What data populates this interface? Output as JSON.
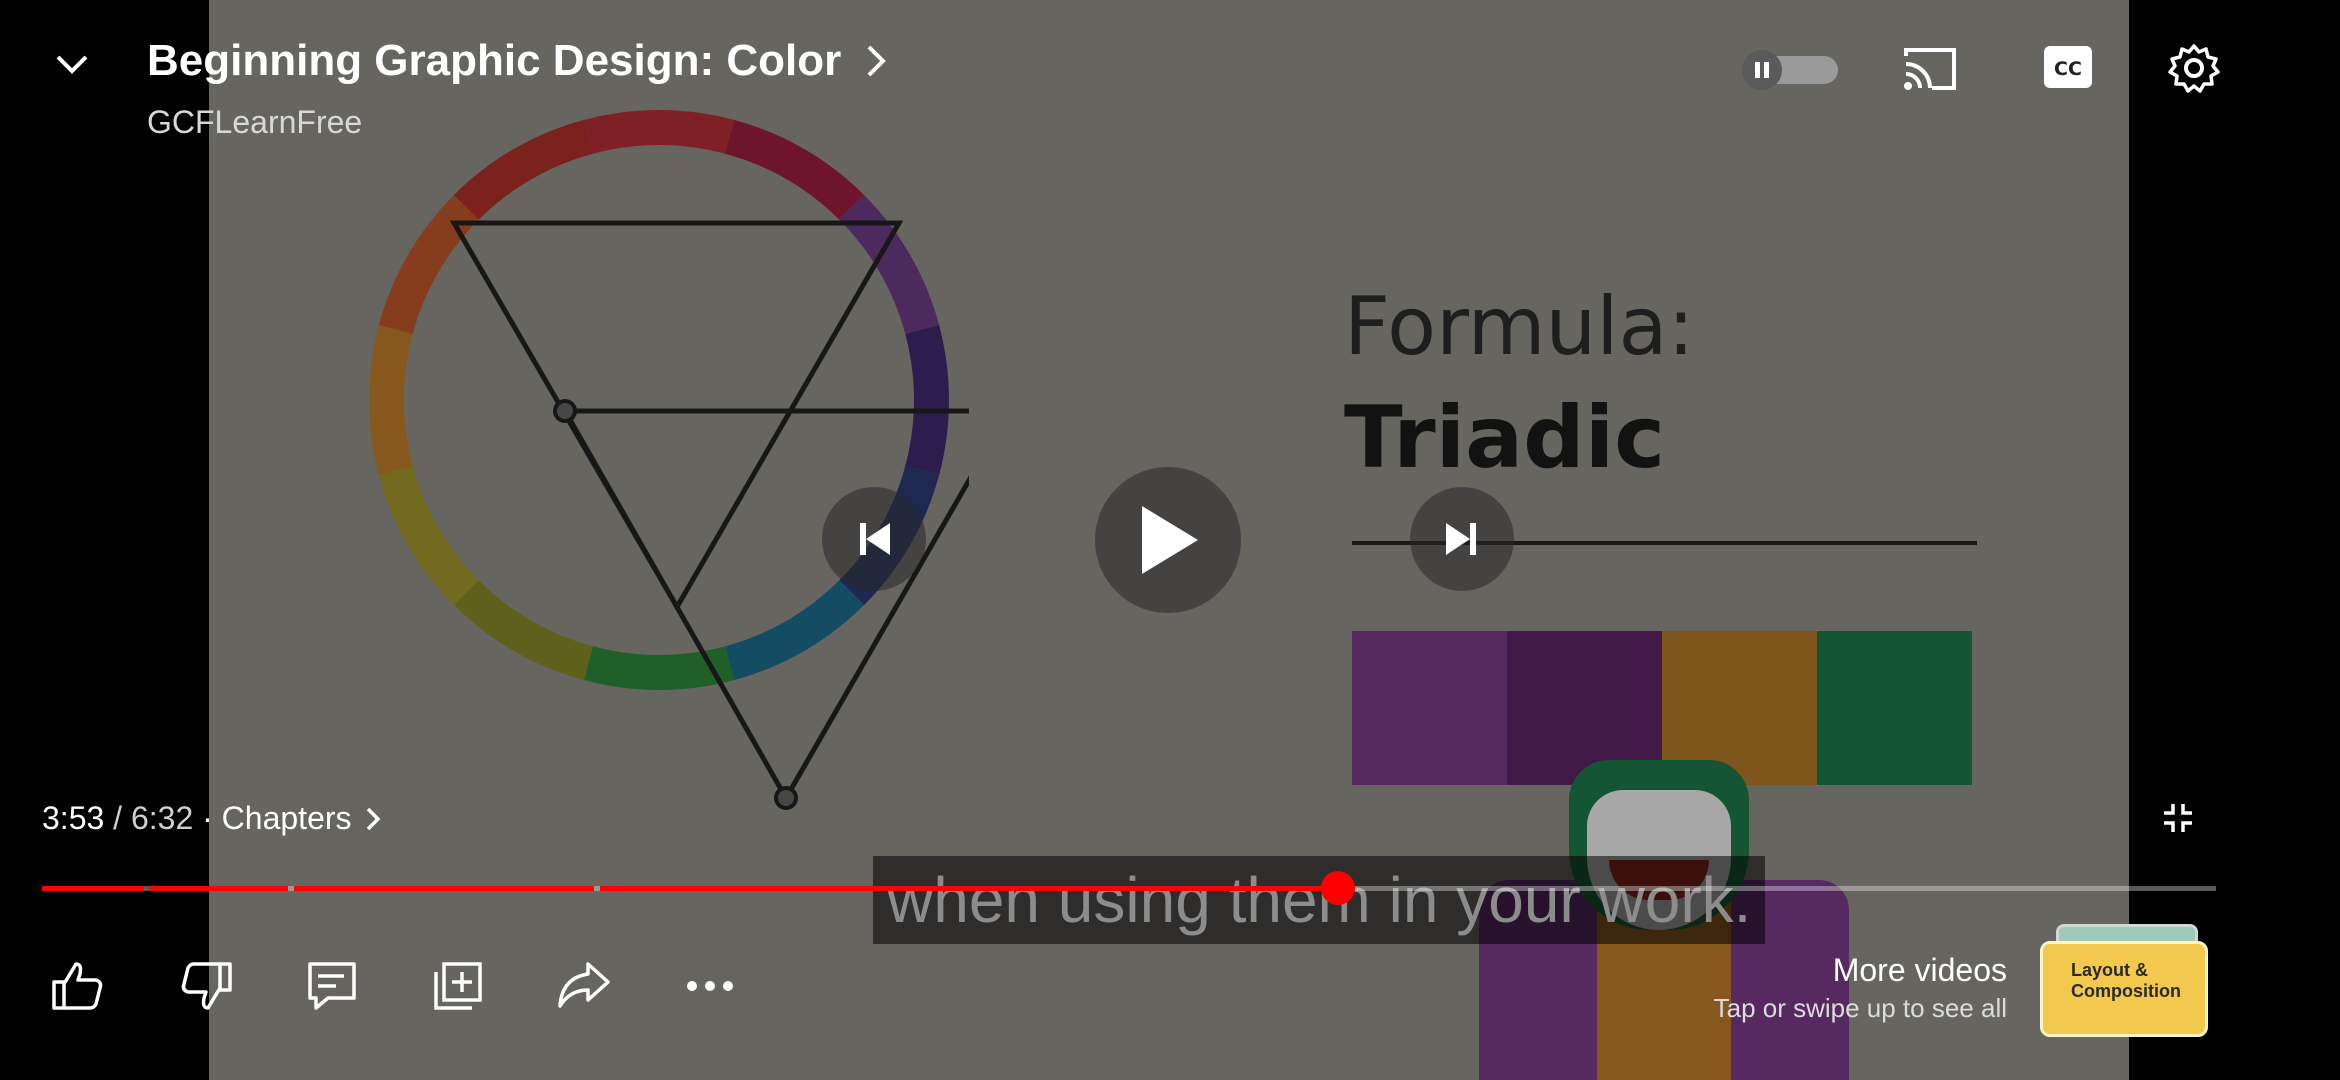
{
  "video": {
    "formula_label": "Formula:",
    "formula_name": "Triadic",
    "caption": "when using them in your work.",
    "swatches": [
      "#7b3c8a",
      "#5c2468",
      "#b77a2c",
      "#1d7a49"
    ],
    "wheel_colors": [
      "#b72f38",
      "#9e1f3e",
      "#6e3d86",
      "#3f2a70",
      "#2c3a73",
      "#1e6e8e",
      "#2f8a3a",
      "#8a8a2a",
      "#a4982c",
      "#c07f2b",
      "#c0582c",
      "#b0312a"
    ]
  },
  "header": {
    "title": "Beginning Graphic Design: Color",
    "channel": "GCFLearnFree"
  },
  "player": {
    "current_time": "3:53",
    "separator": " / ",
    "duration": "6:32",
    "chapters_label": " · Chapters",
    "progress": 0.597
  },
  "actions": {
    "more_videos": "More videos",
    "swipe_hint": "Tap or swipe up to see all",
    "thumb_title": "Layout & Composition"
  },
  "colors": {
    "accent": "#ff0000"
  }
}
